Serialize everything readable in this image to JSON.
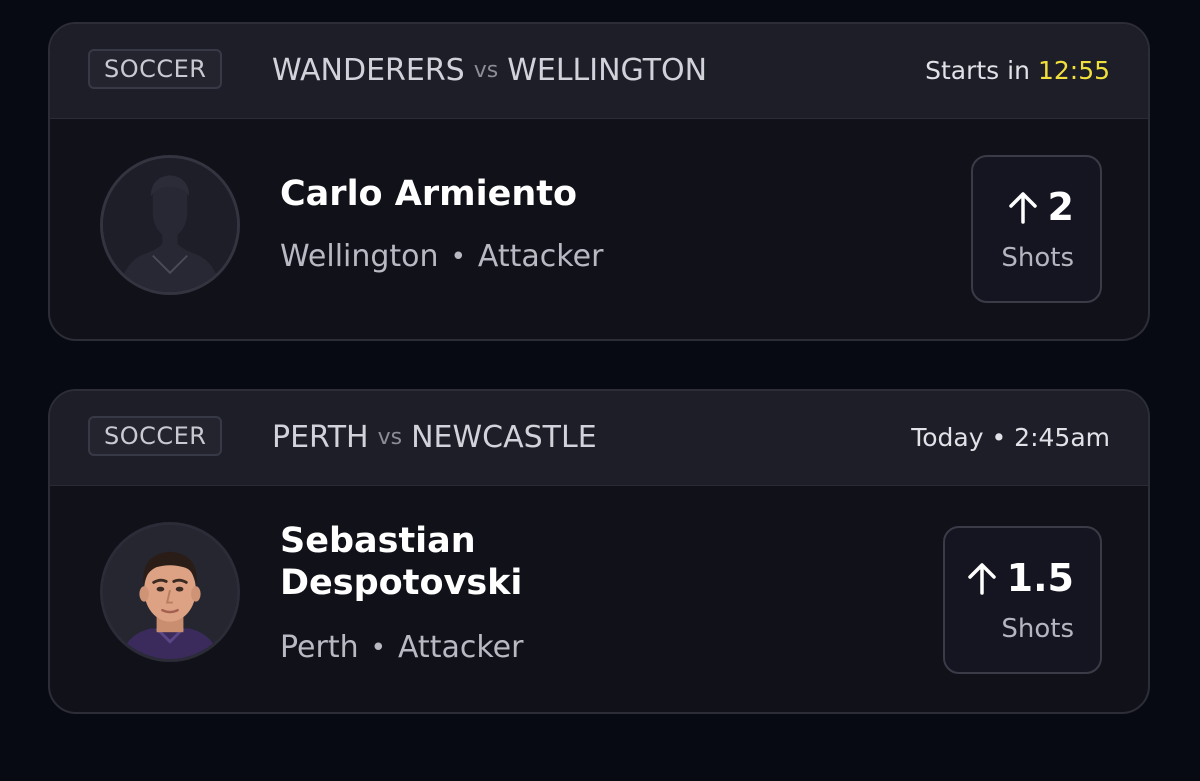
{
  "cards": [
    {
      "sport": "SOCCER",
      "team_home": "WANDERERS",
      "vs": "vs",
      "team_away": "WELLINGTON",
      "time_prefix": "Starts in",
      "countdown": "12:55",
      "player_name": "Carlo Armiento",
      "player_team": "Wellington",
      "separator": "•",
      "player_position": "Attacker",
      "stat_value": "2",
      "stat_label": "Shots",
      "stat_direction_icon": "arrow-up-icon",
      "avatar": "silhouette-placeholder"
    },
    {
      "sport": "SOCCER",
      "team_home": "PERTH",
      "vs": "vs",
      "team_away": "NEWCASTLE",
      "time_text": "Today • 2:45am",
      "player_name_line1": "Sebastian",
      "player_name_line2": "Despotovski",
      "player_team": "Perth",
      "separator": "•",
      "player_position": "Attacker",
      "stat_value": "1.5",
      "stat_label": "Shots",
      "stat_direction_icon": "arrow-up-icon",
      "avatar": "player-photo"
    }
  ],
  "colors": {
    "background": "#080a13",
    "card": "#111219",
    "header": "#1d1e27",
    "countdown": "#f0df3c"
  }
}
